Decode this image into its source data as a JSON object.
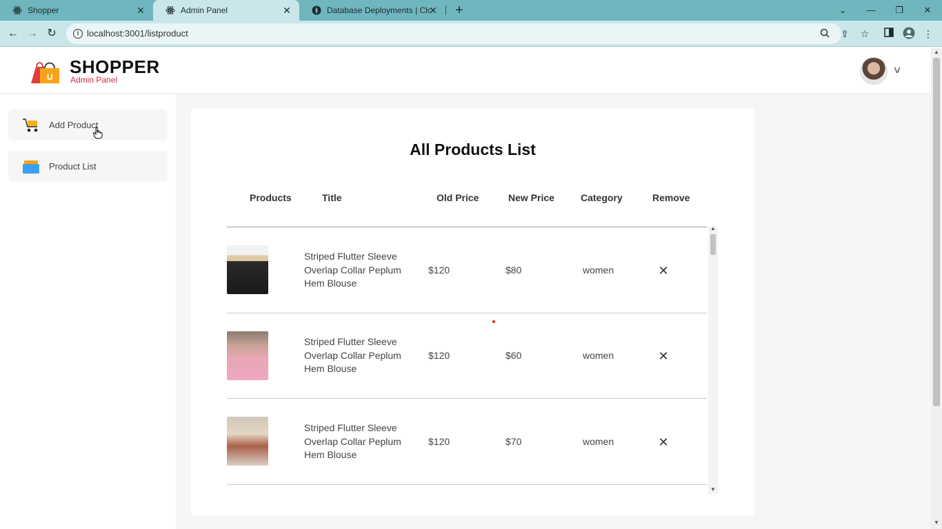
{
  "browser": {
    "tabs": [
      {
        "title": "Shopper",
        "icon": "react-icon"
      },
      {
        "title": "Admin Panel",
        "icon": "react-icon"
      },
      {
        "title": "Database Deployments | Cloud",
        "icon": "mongodb-leaf-icon"
      }
    ],
    "url": "localhost:3001/listproduct"
  },
  "header": {
    "brand": "SHOPPER",
    "subtitle": "Admin Panel"
  },
  "sidebar": {
    "items": [
      {
        "label": "Add Product",
        "icon": "cart-icon"
      },
      {
        "label": "Product List",
        "icon": "product-list-icon"
      }
    ]
  },
  "main": {
    "title": "All Products List",
    "columns": [
      "Products",
      "Title",
      "Old Price",
      "New Price",
      "Category",
      "Remove"
    ],
    "rows": [
      {
        "title": "Striped Flutter Sleeve Overlap Collar Peplum Hem Blouse",
        "old_price": "$120",
        "new_price": "$80",
        "category": "women"
      },
      {
        "title": "Striped Flutter Sleeve Overlap Collar Peplum Hem Blouse",
        "old_price": "$120",
        "new_price": "$60",
        "category": "women"
      },
      {
        "title": "Striped Flutter Sleeve Overlap Collar Peplum Hem Blouse",
        "old_price": "$120",
        "new_price": "$70",
        "category": "women"
      }
    ]
  },
  "colors": {
    "brand_accent": "#d3284a",
    "tab_bar": "#6fb6bf",
    "toolbar": "#c9e7ea"
  }
}
